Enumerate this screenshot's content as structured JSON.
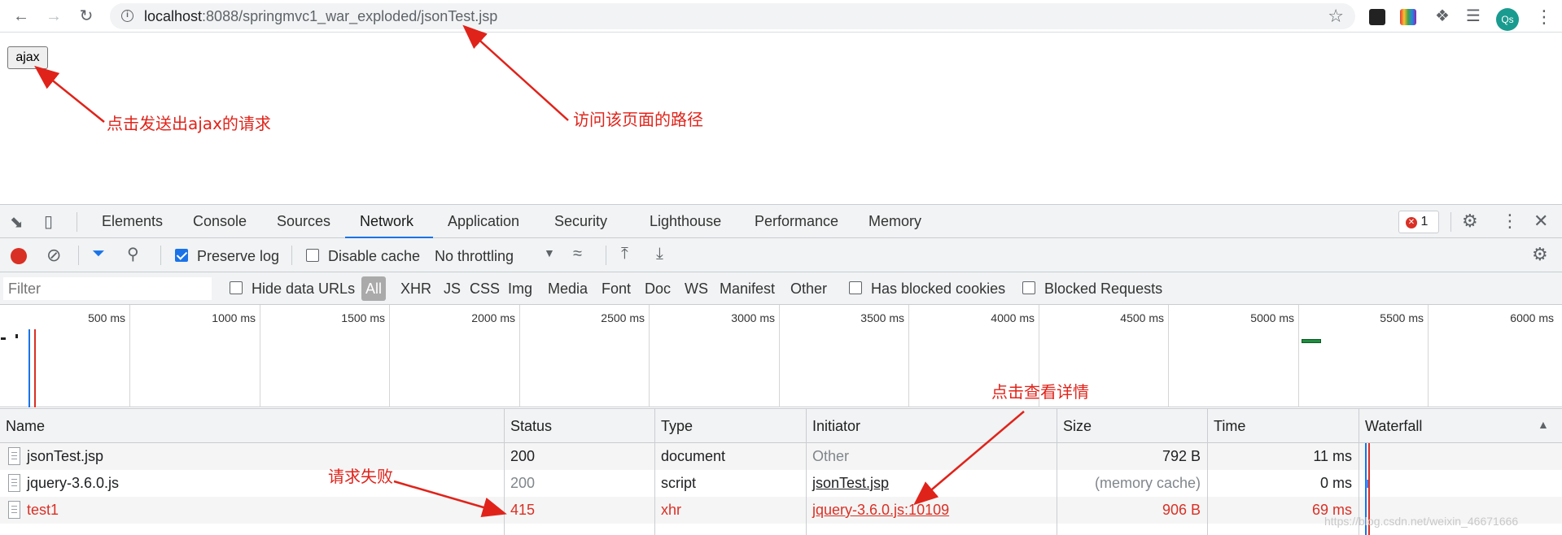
{
  "browser": {
    "url_host": "localhost",
    "url_rest": ":8088/springmvc1_war_exploded/jsonTest.jsp",
    "profile_initials": "Qs"
  },
  "page": {
    "ajax_button_label": "ajax"
  },
  "annotations": {
    "click_ajax": "点击发送出ajax的请求",
    "page_path": "访问该页面的路径",
    "view_details": "点击查看详情",
    "request_failed": "请求失败",
    "color": "#e0231a"
  },
  "devtools": {
    "tabs": [
      "Elements",
      "Console",
      "Sources",
      "Network",
      "Application",
      "Security",
      "Lighthouse",
      "Performance",
      "Memory"
    ],
    "active_tab": "Network",
    "error_count": "1",
    "toolbar": {
      "preserve_log": "Preserve log",
      "preserve_log_checked": true,
      "disable_cache": "Disable cache",
      "disable_cache_checked": false,
      "throttling": "No throttling"
    },
    "filter": {
      "placeholder": "Filter",
      "hide_data_urls": "Hide data URLs",
      "types": [
        "All",
        "XHR",
        "JS",
        "CSS",
        "Img",
        "Media",
        "Font",
        "Doc",
        "WS",
        "Manifest",
        "Other"
      ],
      "active_type": "All",
      "has_blocked_cookies": "Has blocked cookies",
      "blocked_requests": "Blocked Requests"
    },
    "timeline_ticks": [
      "500 ms",
      "1000 ms",
      "1500 ms",
      "2000 ms",
      "2500 ms",
      "3000 ms",
      "3500 ms",
      "4000 ms",
      "4500 ms",
      "5000 ms",
      "5500 ms",
      "6000 ms"
    ],
    "columns": [
      "Name",
      "Status",
      "Type",
      "Initiator",
      "Size",
      "Time",
      "Waterfall"
    ],
    "rows": [
      {
        "name": "jsonTest.jsp",
        "status": "200",
        "type": "document",
        "initiator": "Other",
        "size": "792 B",
        "time": "11 ms"
      },
      {
        "name": "jquery-3.6.0.js",
        "status": "200",
        "type": "script",
        "initiator": "jsonTest.jsp",
        "size": "(memory cache)",
        "time": "0 ms"
      },
      {
        "name": "test1",
        "status": "415",
        "type": "xhr",
        "initiator": "jquery-3.6.0.js:10109",
        "size": "906 B",
        "time": "69 ms"
      }
    ]
  },
  "watermark": "https://blog.csdn.net/weixin_46671666"
}
